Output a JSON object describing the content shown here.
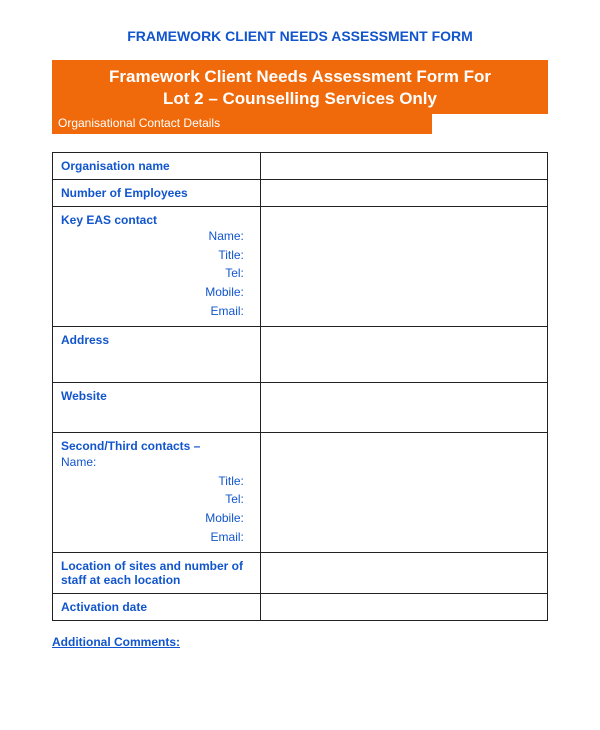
{
  "header": {
    "page_title": "FRAMEWORK CLIENT NEEDS ASSESSMENT FORM",
    "banner_line1": "Framework Client Needs Assessment Form For",
    "banner_line2": "Lot 2 – Counselling Services Only",
    "sub_banner": "Organisational Contact Details"
  },
  "rows": {
    "org_name_label": "Organisation name",
    "org_name_value": "",
    "num_employees_label": "Number of Employees",
    "num_employees_value": "",
    "key_eas_label": "Key EAS contact",
    "key_eas_sub": {
      "name": "Name:",
      "title": "Title:",
      "tel": "Tel:",
      "mobile": "Mobile:",
      "email": "Email:"
    },
    "key_eas_value": "",
    "address_label": "Address",
    "address_value": "",
    "website_label": "Website",
    "website_value": "",
    "second_contacts_label": "Second/Third contacts –",
    "second_contacts_name": "Name:",
    "second_contacts_sub": {
      "title": "Title:",
      "tel": "Tel:",
      "mobile": "Mobile:",
      "email": "Email:"
    },
    "second_contacts_value": "",
    "location_label": "Location of sites and number of staff at each location",
    "location_value": "",
    "activation_label": "Activation date",
    "activation_value": ""
  },
  "footer": {
    "additional_comments": "Additional Comments:"
  }
}
